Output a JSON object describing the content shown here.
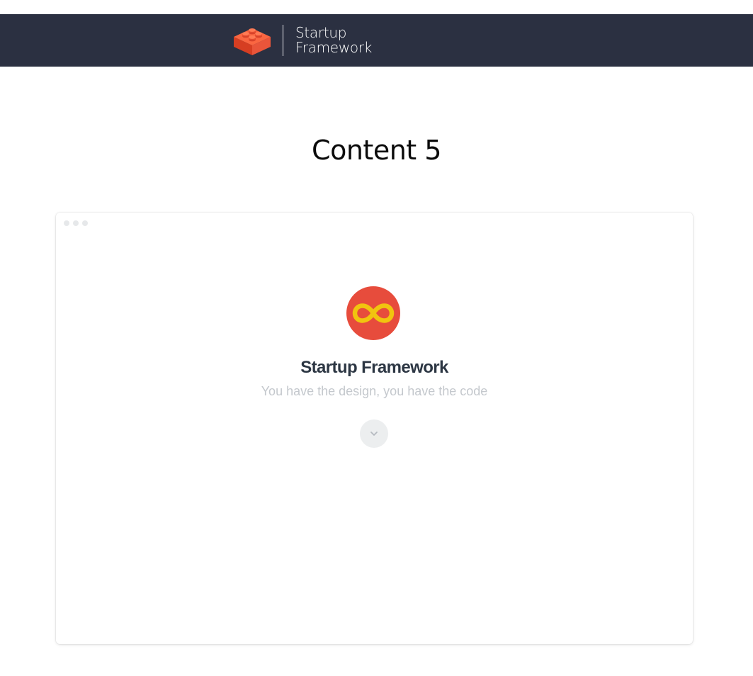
{
  "header": {
    "brand_name_line1": "Startup",
    "brand_name_line2": "Framework",
    "logo_icon": "lego-brick-icon",
    "background_color": "#2b3041"
  },
  "page": {
    "title": "Content 5"
  },
  "preview": {
    "window_dots_icon": "window-controls-icon",
    "hero_icon": "infinity-icon",
    "hero_title": "Startup Framework",
    "hero_subtitle": "You have the design, you have the code",
    "scroll_button_icon": "chevron-down-icon",
    "colors": {
      "icon_background": "#e74c3c",
      "icon_foreground": "#f1c40f",
      "title": "#2c3643",
      "subtitle": "#c4c8cd"
    }
  }
}
